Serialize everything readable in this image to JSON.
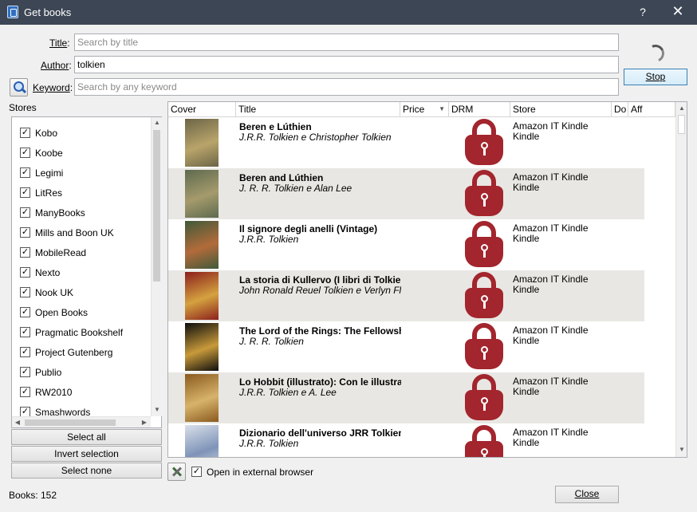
{
  "window": {
    "title": "Get books",
    "help": "?",
    "close": "✕"
  },
  "search": {
    "title_label": "Title",
    "title_placeholder": "Search by title",
    "author_label": "Author",
    "author_value": "tolkien",
    "keyword_label": "Keyword",
    "keyword_placeholder": "Search by any keyword",
    "stop_label": "Stop"
  },
  "stores": {
    "heading": "Stores",
    "items": [
      {
        "name": "Kobo",
        "checked": true
      },
      {
        "name": "Koobe",
        "checked": true
      },
      {
        "name": "Legimi",
        "checked": true
      },
      {
        "name": "LitRes",
        "checked": true
      },
      {
        "name": "ManyBooks",
        "checked": true
      },
      {
        "name": "Mills and Boon UK",
        "checked": true
      },
      {
        "name": "MobileRead",
        "checked": true
      },
      {
        "name": "Nexto",
        "checked": true
      },
      {
        "name": "Nook UK",
        "checked": true
      },
      {
        "name": "Open Books",
        "checked": true
      },
      {
        "name": "Pragmatic Bookshelf",
        "checked": true
      },
      {
        "name": "Project Gutenberg",
        "checked": true
      },
      {
        "name": "Publio",
        "checked": true
      },
      {
        "name": "RW2010",
        "checked": true
      },
      {
        "name": "Smashwords",
        "checked": true
      }
    ],
    "select_all": "Select all",
    "invert_selection": "Invert selection",
    "select_none": "Select none"
  },
  "results": {
    "columns": [
      "Cover",
      "Title",
      "Price",
      "DRM",
      "Store",
      "Do",
      "Aff"
    ],
    "rows": [
      {
        "title": "Beren e Lúthien",
        "author": "J.R.R. Tolkien e Christopher Tolkien",
        "store": "Amazon IT Kindle",
        "format": "Kindle",
        "cover_colors": [
          "#6b6547",
          "#b9a46a"
        ]
      },
      {
        "title": "Beren and Lúthien",
        "author": "J. R. R. Tolkien e Alan Lee",
        "store": "Amazon IT Kindle",
        "format": "Kindle",
        "cover_colors": [
          "#5d6a4e",
          "#a59a6c"
        ]
      },
      {
        "title": "Il signore degli anelli (Vintage)",
        "author": "J.R.R. Tolkien",
        "store": "Amazon IT Kindle",
        "format": "Kindle",
        "cover_colors": [
          "#3f5a3a",
          "#b36b3a"
        ]
      },
      {
        "title": "La storia di Kullervo (I libri di Tolkien",
        "author": "John Ronald Reuel Tolkien e Verlyn Flieger",
        "store": "Amazon IT Kindle",
        "format": "Kindle",
        "cover_colors": [
          "#8c1f1c",
          "#d4a23f"
        ]
      },
      {
        "title": "The Lord of the Rings: The Fellowship",
        "author": "J. R. R. Tolkien",
        "store": "Amazon IT Kindle",
        "format": "Kindle",
        "cover_colors": [
          "#0d0d0d",
          "#c89a3a"
        ]
      },
      {
        "title": "Lo Hobbit (illustrato): Con le illustraz",
        "author": "J.R.R. Tolkien e A. Lee",
        "store": "Amazon IT Kindle",
        "format": "Kindle",
        "cover_colors": [
          "#8a5a1f",
          "#d7b36a"
        ]
      },
      {
        "title": "Dizionario dell'universo JRR Tolkien",
        "author": "J.R.R. Tolkien",
        "store": "Amazon IT Kindle",
        "format": "Kindle",
        "cover_colors": [
          "#d9e0ea",
          "#7f94b8"
        ]
      }
    ]
  },
  "footer": {
    "open_external_label": "Open in external browser",
    "open_external_checked": true,
    "books_label": "Books:",
    "books_count": "152",
    "close_label": "Close"
  }
}
